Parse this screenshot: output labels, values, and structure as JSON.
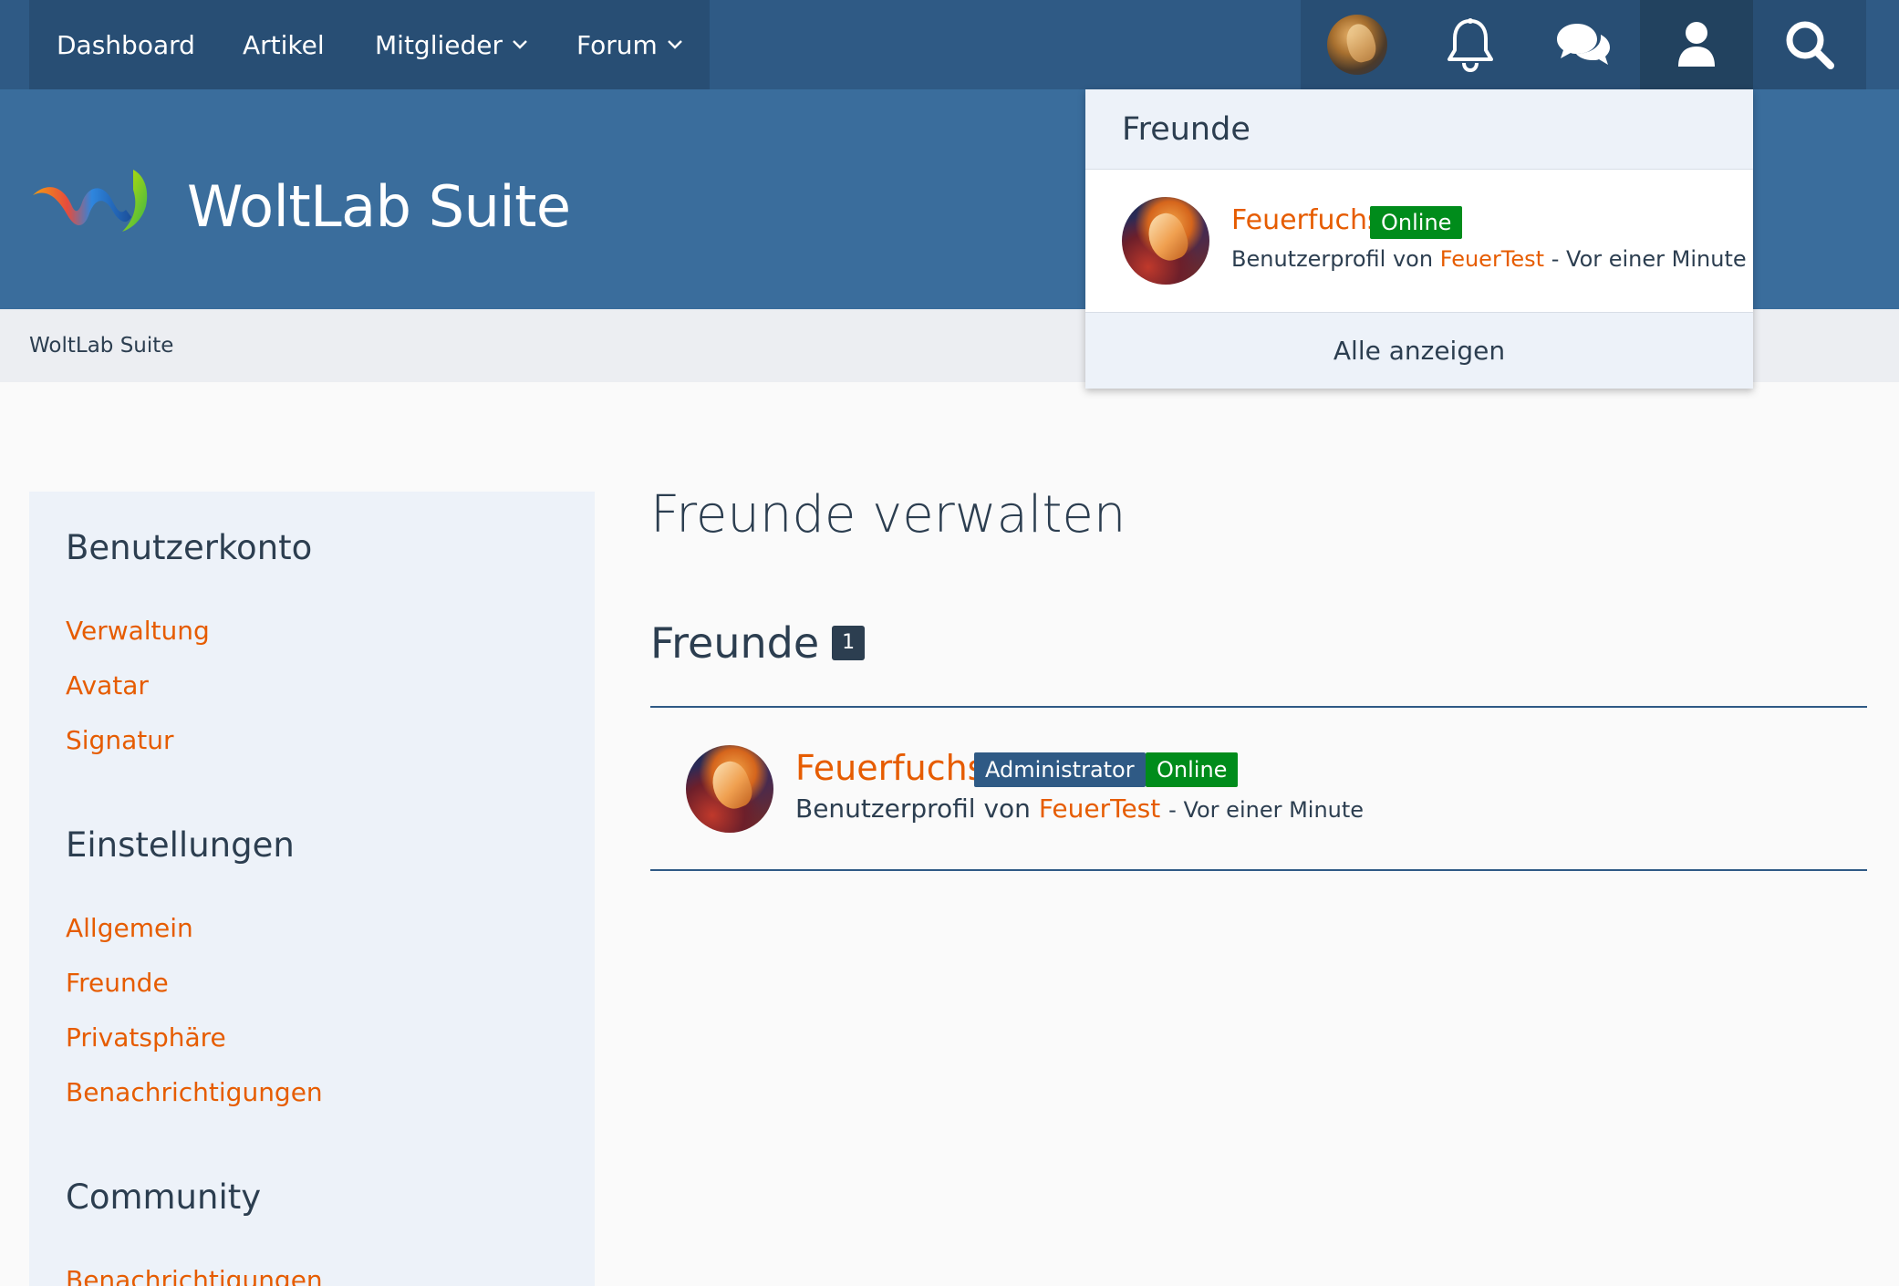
{
  "nav": {
    "items": [
      {
        "label": "Dashboard"
      },
      {
        "label": "Artikel"
      },
      {
        "label": "Mitglieder"
      },
      {
        "label": "Forum"
      }
    ]
  },
  "usermenu": {
    "icons": [
      "user-avatar",
      "bell-icon",
      "comments-icon",
      "user-icon",
      "search-icon"
    ]
  },
  "header": {
    "logo_text": "WoltLab Suite"
  },
  "breadcrumb": {
    "label": "WoltLab Suite"
  },
  "dropdown": {
    "title": "Freunde",
    "friend": {
      "name": "Feuerfuchs",
      "status": "Online",
      "meta_prefix": "Benutzerprofil von",
      "meta_link": "FeuerTest",
      "meta_time": "- Vor einer Minute"
    },
    "footer": "Alle anzeigen"
  },
  "sidebar": {
    "sections": [
      {
        "title": "Benutzerkonto",
        "links": [
          "Verwaltung",
          "Avatar",
          "Signatur"
        ]
      },
      {
        "title": "Einstellungen",
        "links": [
          "Allgemein",
          "Freunde",
          "Privatsphäre",
          "Benachrichtigungen"
        ]
      },
      {
        "title": "Community",
        "links": [
          "Benachrichtigungen"
        ]
      }
    ]
  },
  "main": {
    "title": "Freunde verwalten",
    "section_title": "Freunde",
    "count": "1",
    "friends": [
      {
        "name": "Feuerfuchs",
        "role_badge": "Administrator",
        "status": "Online",
        "meta_prefix": "Benutzerprofil von",
        "meta_link": "FeuerTest",
        "meta_time": "- Vor einer Minute"
      }
    ]
  },
  "colors": {
    "topbar": "#2f5a85",
    "header": "#3a6d9c",
    "link": "#e65c00",
    "online": "#008c1b",
    "admin_badge": "#2f5a85"
  }
}
